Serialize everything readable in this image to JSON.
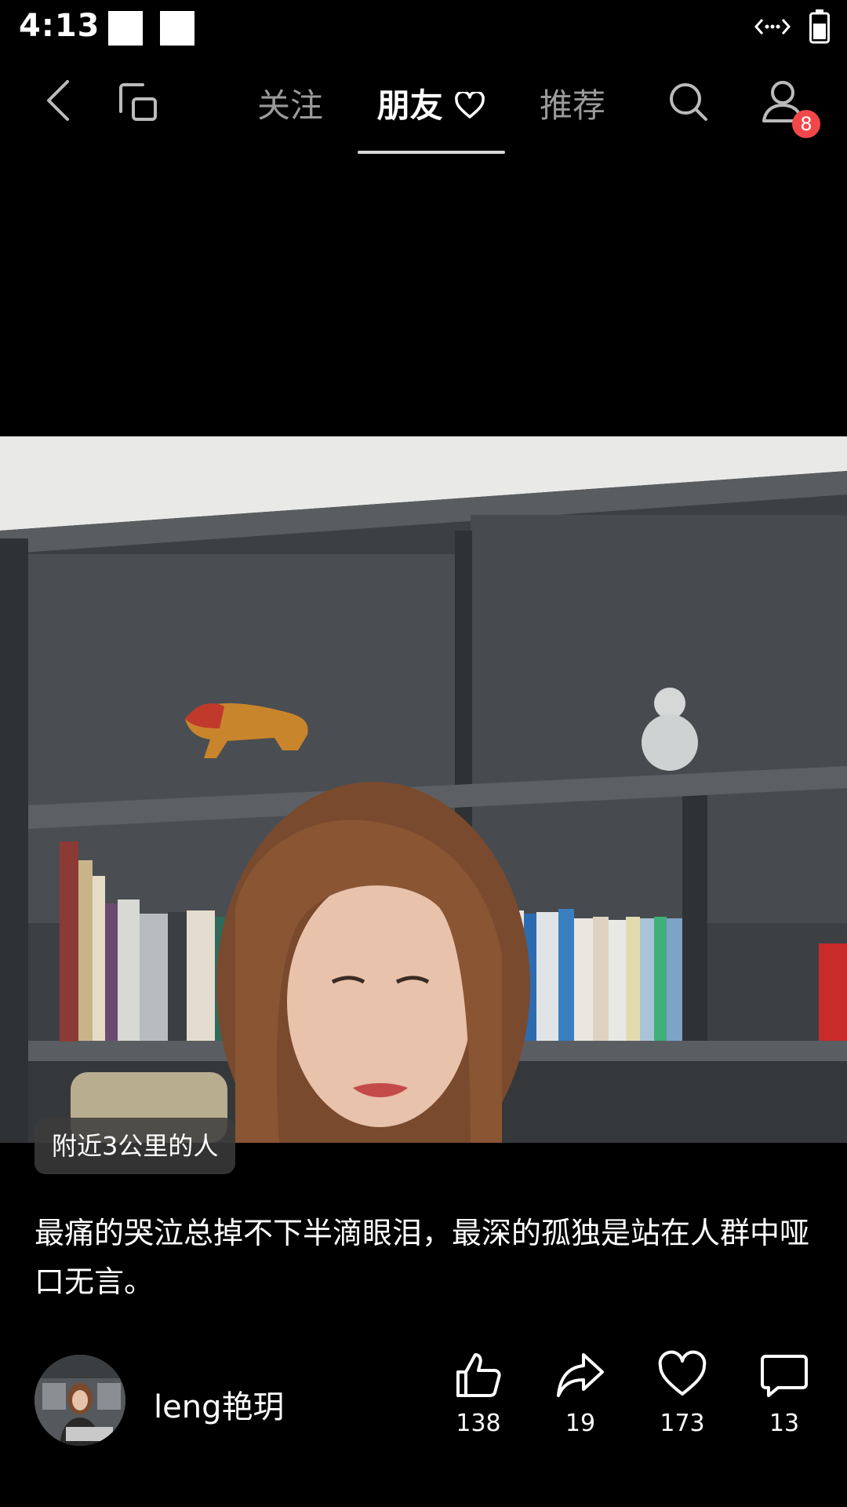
{
  "status_bar": {
    "time": "4:13",
    "network_icon": "data-transfer-icon",
    "battery_icon": "battery-icon"
  },
  "top_nav": {
    "back_icon": "back-icon",
    "switch_icon": "switch-screen-icon",
    "tabs": [
      {
        "label": "关注",
        "active": false
      },
      {
        "label": "朋友",
        "active": true,
        "icon": "heart-outline-icon"
      },
      {
        "label": "推荐",
        "active": false
      }
    ],
    "search_icon": "search-icon",
    "profile_icon": "profile-icon",
    "notification_count": "8"
  },
  "post": {
    "location_tag": "附近3公里的人",
    "caption": "最痛的哭泣总掉不下半滴眼泪，最深的孤独是站在人群中哑口无言。",
    "author": "leng艳玥",
    "actions": [
      {
        "name": "like",
        "icon": "thumbs-up-icon",
        "count": "138"
      },
      {
        "name": "share",
        "icon": "share-icon",
        "count": "19"
      },
      {
        "name": "favorite",
        "icon": "heart-icon",
        "count": "173"
      },
      {
        "name": "comment",
        "icon": "comment-icon",
        "count": "13"
      }
    ]
  },
  "colors": {
    "background": "#000000",
    "badge": "#f2474a",
    "inactive_tab": "#9a9a9a"
  }
}
